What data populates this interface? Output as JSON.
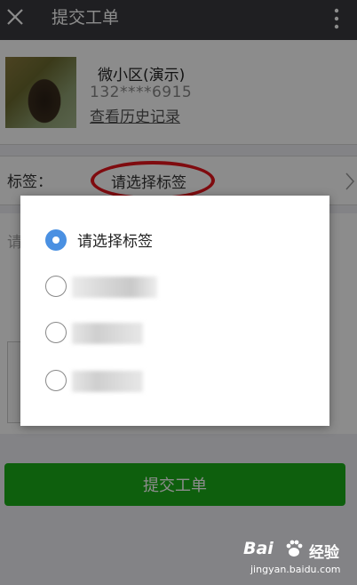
{
  "app": {
    "title": "提交工单"
  },
  "profile": {
    "name": "微小区(演示)",
    "phone": "132****6915",
    "history_link": "查看历史记录"
  },
  "form": {
    "tag_label": "标签：",
    "tag_value": "请选择标签",
    "content_hint": "请",
    "submit_label": "提交工单"
  },
  "dialog": {
    "options": [
      {
        "label": "请选择标签",
        "selected": true
      },
      {
        "label": "",
        "selected": false
      },
      {
        "label": "",
        "selected": false
      },
      {
        "label": "",
        "selected": false
      }
    ]
  },
  "watermark": {
    "brand": "Bai",
    "suffix": "经验",
    "url": "jingyan.baidu.com"
  },
  "colors": {
    "topbar": "#393a3f",
    "accent_green": "#1aad19",
    "radio_selected": "#4a90e2",
    "highlight_red": "#e8141d"
  },
  "icons": [
    "close-icon",
    "more-icon",
    "chevron-right-icon",
    "radio-selected-icon",
    "radio-unselected-icon"
  ]
}
